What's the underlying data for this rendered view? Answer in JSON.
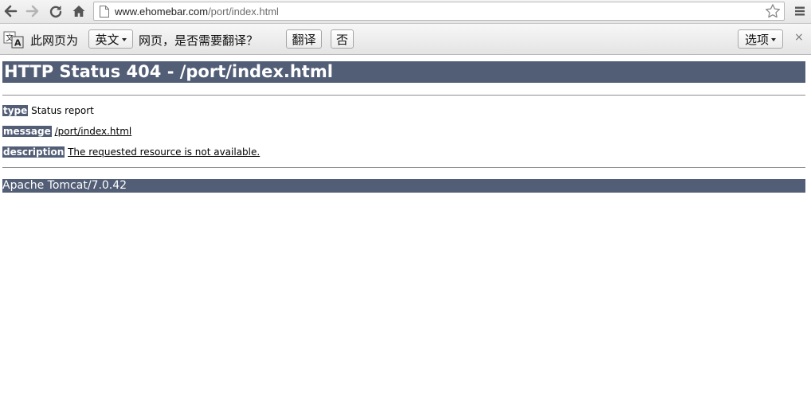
{
  "browser": {
    "url_host": "www.ehomebar.com",
    "url_path": "/port/index.html",
    "icons": [
      "back-icon",
      "forward-icon",
      "reload-icon",
      "home-icon",
      "page-icon",
      "star-icon",
      "menu-icon"
    ]
  },
  "translate_bar": {
    "prefix": "此网页为",
    "language": "英文",
    "question": "网页，是否需要翻译？",
    "translate_label": "翻译",
    "no_label": "否",
    "options_label": "选项",
    "close_glyph": "×"
  },
  "page": {
    "title": "HTTP Status 404 - /port/index.html",
    "type_label": "type",
    "type_value": "Status report",
    "message_label": "message",
    "message_value": "/port/index.html",
    "description_label": "description",
    "description_value": "The requested resource is not available.",
    "footer": "Apache Tomcat/7.0.42"
  },
  "colors": {
    "tomcat_header": "#525d76"
  }
}
